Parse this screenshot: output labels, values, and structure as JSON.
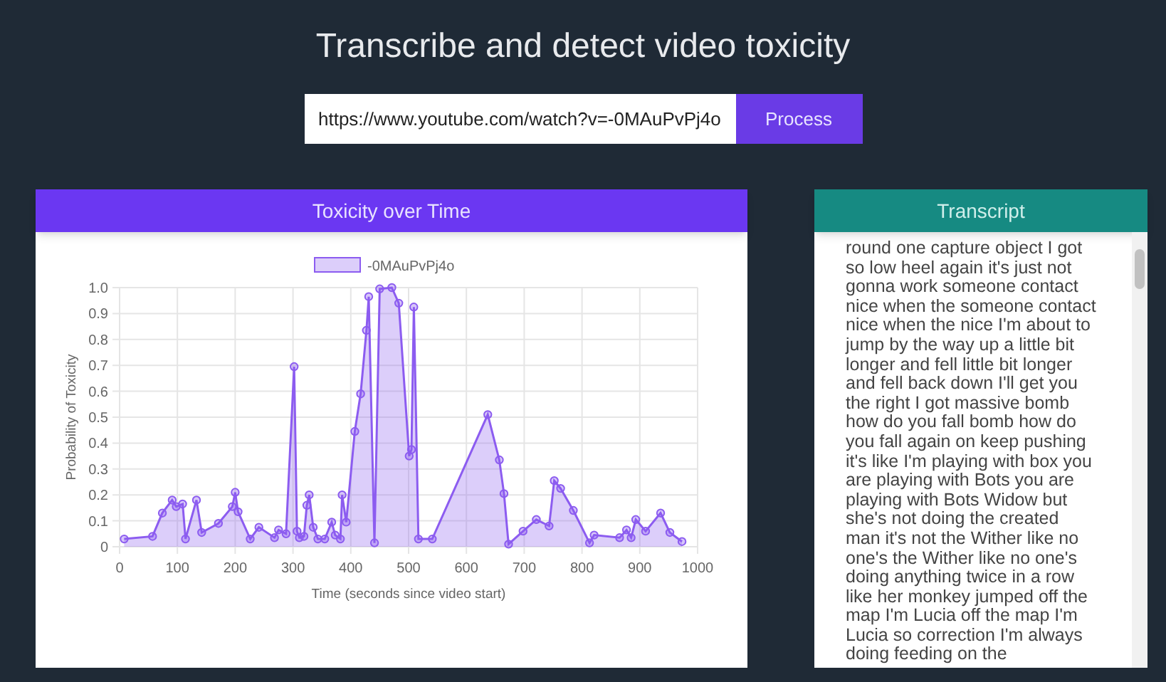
{
  "title": "Transcribe and detect video toxicity",
  "url_field": {
    "value": "https://www.youtube.com/watch?v=-0MAuPvPj4o"
  },
  "process_button": "Process",
  "chart_panel": {
    "title": "Toxicity over Time",
    "chart_data": {
      "type": "area",
      "grid": true,
      "xlabel": "Time (seconds since video start)",
      "ylabel": "Probability of Toxicity",
      "xlim": [
        0,
        1000
      ],
      "ylim": [
        0,
        1
      ],
      "xticks": [
        0,
        100,
        200,
        300,
        400,
        500,
        600,
        700,
        800,
        900,
        1000
      ],
      "yticks": [
        {
          "value": 0,
          "label": "0"
        },
        {
          "value": 0.1,
          "label": "0.1"
        },
        {
          "value": 0.2,
          "label": "0.2"
        },
        {
          "value": 0.3,
          "label": "0.3"
        },
        {
          "value": 0.4,
          "label": "0.4"
        },
        {
          "value": 0.5,
          "label": "0.5"
        },
        {
          "value": 0.6,
          "label": "0.6"
        },
        {
          "value": 0.7,
          "label": "0.7"
        },
        {
          "value": 0.8,
          "label": "0.8"
        },
        {
          "value": 0.9,
          "label": "0.9"
        },
        {
          "value": 1,
          "label": "1.0"
        }
      ],
      "x": [
        8,
        57,
        74,
        91,
        98,
        109,
        114,
        133,
        142,
        171,
        195,
        200,
        205,
        226,
        241,
        268,
        275,
        288,
        302,
        307,
        311,
        319,
        324,
        328,
        335,
        343,
        355,
        367,
        373,
        382,
        385,
        392,
        407,
        417,
        427,
        431,
        441,
        450,
        471,
        483,
        501,
        505,
        509,
        517,
        541,
        637,
        657,
        665,
        673,
        698,
        721,
        743,
        752,
        763,
        785,
        813,
        821,
        865,
        877,
        885,
        893,
        910,
        936,
        952,
        973
      ],
      "series": [
        {
          "name": "-0MAuPvPj4o",
          "color": "#8c5cf0",
          "values": [
            0.03,
            0.04,
            0.13,
            0.18,
            0.155,
            0.165,
            0.03,
            0.18,
            0.055,
            0.09,
            0.155,
            0.21,
            0.135,
            0.03,
            0.075,
            0.035,
            0.065,
            0.05,
            0.695,
            0.06,
            0.035,
            0.04,
            0.16,
            0.2,
            0.075,
            0.03,
            0.03,
            0.095,
            0.045,
            0.03,
            0.2,
            0.095,
            0.445,
            0.59,
            0.835,
            0.965,
            0.015,
            0.995,
            1.0,
            0.94,
            0.35,
            0.375,
            0.925,
            0.03,
            0.03,
            0.51,
            0.335,
            0.205,
            0.01,
            0.06,
            0.105,
            0.08,
            0.255,
            0.225,
            0.14,
            0.015,
            0.045,
            0.035,
            0.065,
            0.035,
            0.105,
            0.06,
            0.13,
            0.055,
            0.02
          ]
        }
      ]
    }
  },
  "transcript_panel": {
    "title": "Transcript",
    "text": "round one capture object I got so low heel again it's just not gonna work someone contact nice when the someone contact nice when the nice I'm about to jump by the way up a little bit longer and fell little bit longer and fell back down I'll get you the right I got massive bomb how do you fall bomb how do you fall again on keep pushing it's like I'm playing with box you are playing with Bots you are playing with Bots Widow but she's not doing the created man it's not the Wither like no one's the Wither like no one's doing anything twice in a row like her monkey jumped off the map I'm Lucia off the map I'm Lucia so correction I'm always doing feeding on the"
  }
}
